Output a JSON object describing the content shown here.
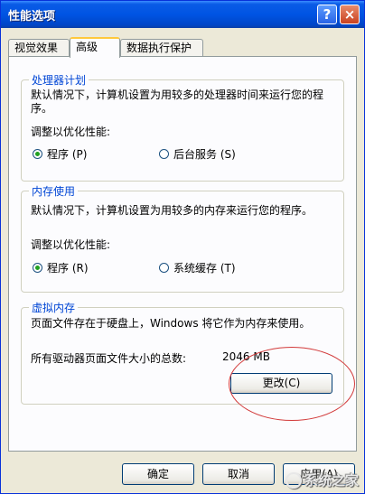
{
  "window": {
    "title": "性能选项",
    "help_label": "?",
    "close_label": "×"
  },
  "tabs": [
    {
      "label": "视觉效果",
      "active": false
    },
    {
      "label": "高级",
      "active": true
    },
    {
      "label": "数据执行保护",
      "active": false
    }
  ],
  "processor": {
    "group_title": "处理器计划",
    "description": "默认情况下，计算机设置为用较多的处理器时间来运行您的程序。",
    "optimize_label": "调整以优化性能:",
    "options": [
      {
        "label": "程序 (P)",
        "checked": true
      },
      {
        "label": "后台服务 (S)",
        "checked": false
      }
    ]
  },
  "memory": {
    "group_title": "内存使用",
    "description": "默认情况下，计算机设置为用较多的内存来运行您的程序。",
    "optimize_label": "调整以优化性能:",
    "options": [
      {
        "label": "程序 (R)",
        "checked": true
      },
      {
        "label": "系统缓存 (T)",
        "checked": false
      }
    ]
  },
  "virtual_memory": {
    "group_title": "虚拟内存",
    "description": "页面文件存在于硬盘上，Windows 将它作为内存来使用。",
    "total_label": "所有驱动器页面文件大小的总数:",
    "total_value": "2046 MB",
    "change_button": "更改(C)"
  },
  "footer": {
    "ok_button": "确定",
    "cancel_button": "取消",
    "apply_button": "应用(A)"
  },
  "watermark": {
    "text": "系统之家"
  }
}
